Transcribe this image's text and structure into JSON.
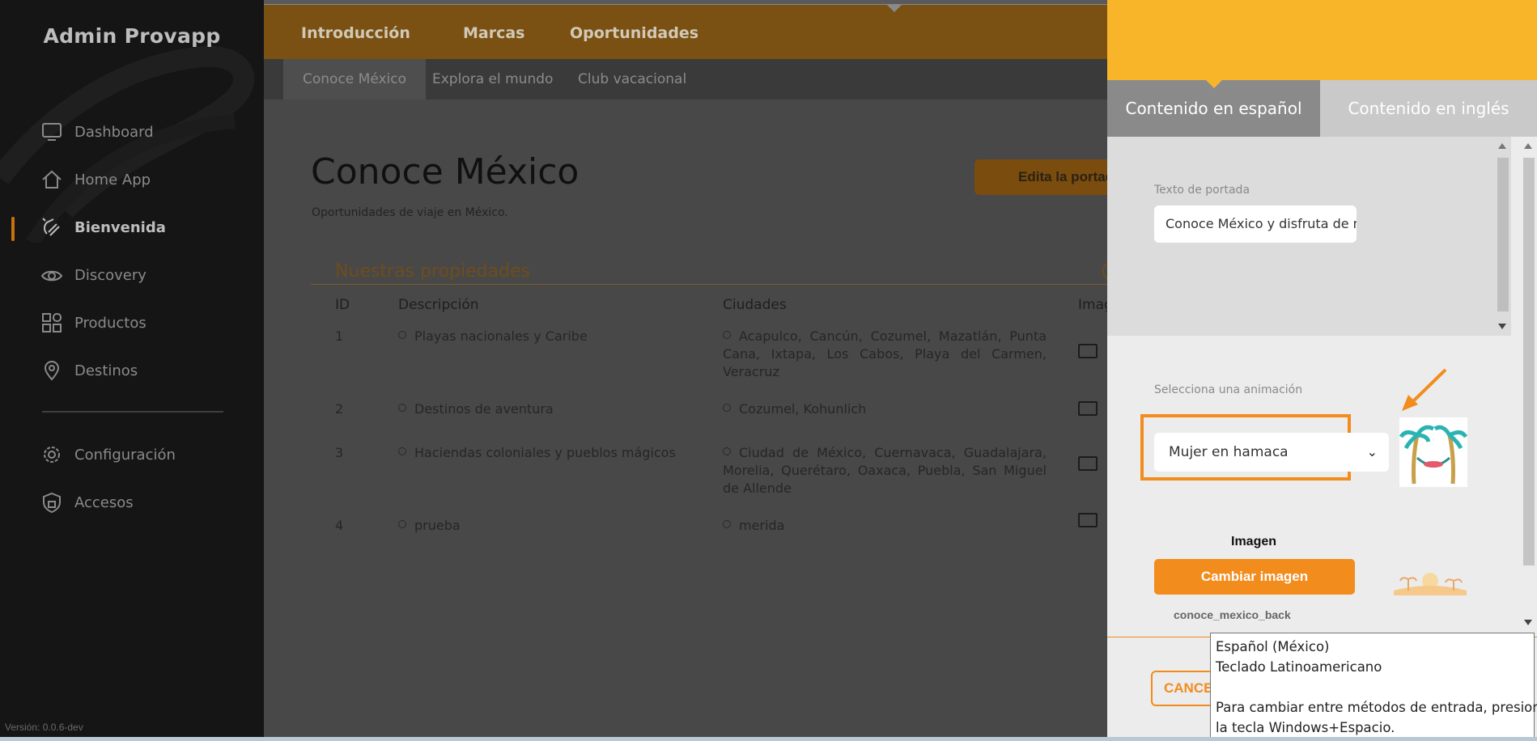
{
  "app": {
    "title": "Admin Provapp",
    "version": "Versión: 0.0.6-dev"
  },
  "sidebar": {
    "items": [
      {
        "label": "Dashboard",
        "icon": "monitor-icon"
      },
      {
        "label": "Home App",
        "icon": "home-icon"
      },
      {
        "label": "Bienvenida",
        "icon": "wave-hand-icon",
        "active": true
      },
      {
        "label": "Discovery",
        "icon": "eye-icon"
      },
      {
        "label": "Productos",
        "icon": "grid-icon"
      },
      {
        "label": "Destinos",
        "icon": "map-pin-icon"
      }
    ],
    "bottom_items": [
      {
        "label": "Configuración",
        "icon": "gear-icon"
      },
      {
        "label": "Accesos",
        "icon": "shield-lock-icon"
      }
    ]
  },
  "topnav": {
    "tabs": [
      "Introducción",
      "Marcas",
      "Oportunidades"
    ]
  },
  "subnav": {
    "tabs": [
      "Conoce México",
      "Explora el mundo",
      "Club vacacional"
    ]
  },
  "main": {
    "title": "Conoce México",
    "subtitle": "Oportunidades de viaje en México.",
    "edit_button": "Edita la portada",
    "section_title": "Nuestras propiedades",
    "columns": [
      "ID",
      "Descripción",
      "Ciudades",
      "Imagen"
    ],
    "rows": [
      {
        "id": "1",
        "desc": "Playas nacionales y Caribe",
        "cities": "Acapulco, Cancún, Cozumel, Mazatlán, Punta Cana, Ixtapa, Los Cabos, Playa del Carmen, Veracruz"
      },
      {
        "id": "2",
        "desc": "Destinos de aventura",
        "cities": "Cozumel, Kohunlich"
      },
      {
        "id": "3",
        "desc": "Haciendas coloniales y pueblos mágicos",
        "cities": "Ciudad de México, Cuernavaca, Guadalajara, Morelia, Querétaro, Oaxaca, Puebla, San Miguel de Allende"
      },
      {
        "id": "4",
        "desc": "prueba",
        "cities": "merida"
      }
    ]
  },
  "panel": {
    "tab_es": "Contenido en español",
    "tab_en": "Contenido en inglés",
    "cover_text_label": "Texto de portada",
    "cover_text_value": "Conoce México y disfruta de n",
    "animation_label": "Selecciona una animación",
    "animation_selected": "Mujer en hamaca",
    "image_title": "Imagen",
    "change_image_button": "Cambiar imagen",
    "file_name": "conoce_mexico_back",
    "cancel_button": "CANCELAR"
  },
  "tooltip": {
    "line1": "Español (México)",
    "line2": "Teclado Latinoamericano",
    "line3": "Para cambiar entre métodos de entrada, presione",
    "line4": "la tecla Windows+Espacio."
  },
  "colors": {
    "accent": "#f28c1c",
    "panel_header": "#f8b52a",
    "sidebar": "#151515"
  }
}
